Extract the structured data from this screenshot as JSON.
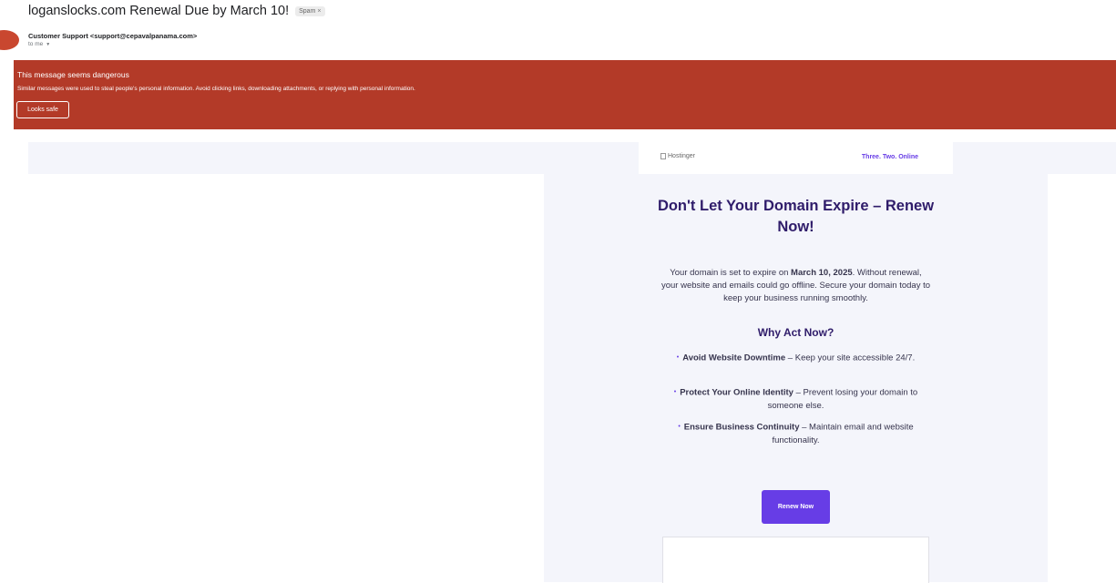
{
  "email": {
    "subject": "loganslocks.com Renewal Due by March 10!",
    "spam_label": "Spam",
    "spam_close": "×",
    "sender": "Customer Support <support@cepavalpanama.com>",
    "to_me": "to me",
    "to_me_caret": "▼"
  },
  "warning": {
    "title": "This message seems dangerous",
    "description": "Similar messages were used to steal people's personal information. Avoid clicking links, downloading attachments, or replying with personal information.",
    "looks_safe_label": "Looks safe"
  },
  "message": {
    "logo_alt": "Hostinger",
    "tagline": "Three. Two. Online",
    "headline": "Don't Let Your Domain Expire – Renew Now!",
    "body_before": "Your domain is set to expire on ",
    "body_date": "March 10, 2025",
    "body_after": ". Without renewal, your website and emails could go offline. Secure your domain today to keep your business running smoothly.",
    "subhead": "Why Act Now?",
    "bullets": [
      {
        "bold": "Avoid Website Downtime",
        "text": " – Keep your site accessible 24/7."
      },
      {
        "bold": "Protect Your Online Identity",
        "text": " – Prevent losing your domain to someone else."
      },
      {
        "bold": "Ensure Business Continuity",
        "text": " – Maintain email and website functionality."
      }
    ],
    "button_label": "Renew Now",
    "bullet_glyph": "•"
  },
  "colors": {
    "warning_banner": "#b33a28",
    "accent": "#673de6",
    "heading": "#2f1c6a",
    "email_background": "#f4f5fb"
  }
}
